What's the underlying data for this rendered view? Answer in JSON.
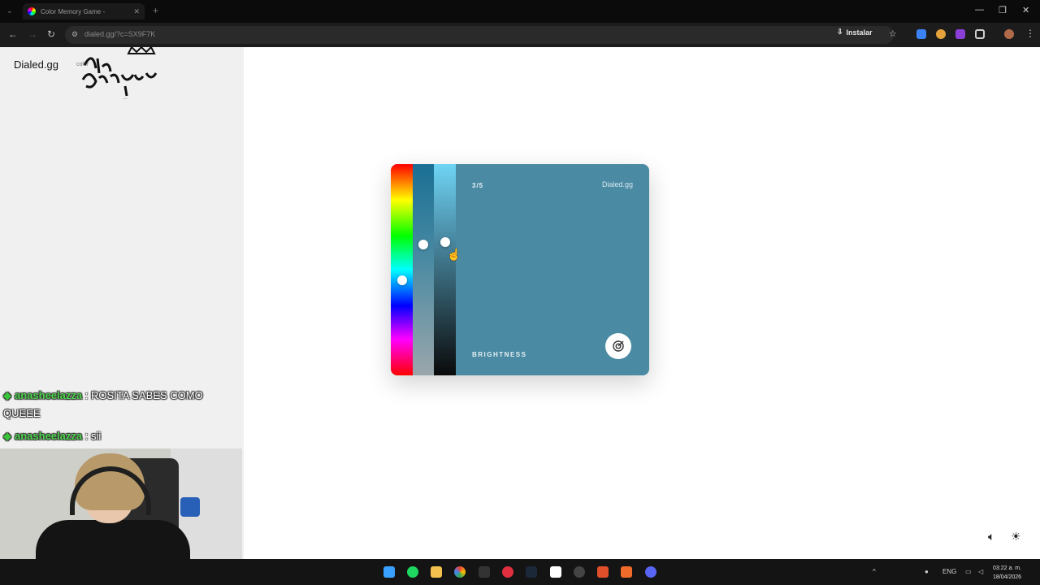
{
  "browser": {
    "tab_title": "Color Memory Game - ",
    "url": "dialed.gg/?c=SX9F7K",
    "install_label": "Instalar"
  },
  "stream": {
    "brand": "Dialed.gg",
    "brand_sub": "color",
    "sticker_text": "La Bandolera",
    "chat": [
      {
        "user": "anasheelazza",
        "message": ": ROSITA SABES COMO QUEEE"
      },
      {
        "user": "anasheelazza",
        "message": ": sii"
      }
    ]
  },
  "game": {
    "round": "3/5",
    "brand": "Dialed.gg",
    "mode": "BRIGHTNESS",
    "current_color": "#4a8aa3"
  },
  "taskbar": {
    "language": "ENG",
    "time": "03:22 a. m.",
    "date": "18/04/2026"
  }
}
